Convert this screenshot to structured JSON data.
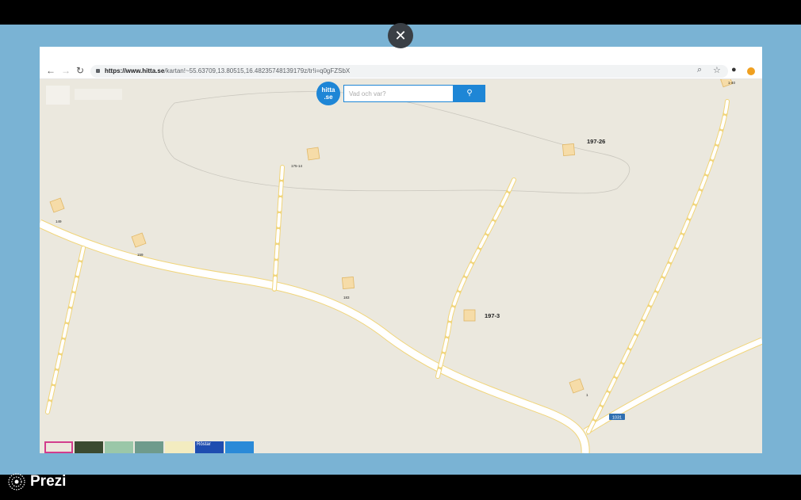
{
  "presentation": {
    "brand": "Prezi",
    "close_symbol": "✕"
  },
  "browser": {
    "url_host": "https://www.hitta.se",
    "url_path": "/kartan!~55.63709,13.80515,16.48235748139179z/tr!i=q0gFZSbX",
    "icons": [
      "back-arrow-icon",
      "forward-arrow-icon",
      "reload-icon",
      "lock-icon",
      "zoom-icon",
      "star-icon",
      "account-icon",
      "extension-icon"
    ]
  },
  "hitta": {
    "logo_line1": "hitta",
    "logo_line2": ".se",
    "search_placeholder": "Vad och var?"
  },
  "map": {
    "labels": {
      "l197_26": "197-26",
      "l197_3": "197-3",
      "l175_14": "175-14",
      "l149": "149",
      "l159": "159",
      "l183": "183",
      "l1": "1",
      "l1_40": "1-40",
      "road_1031": "1031"
    },
    "thumb_rostar": "Röstar"
  },
  "colors": {
    "map_bg": "#ebe8de",
    "road": "#ffffff",
    "road_edge": "#f1d57a",
    "building": "#f6dca8",
    "stage_blue": "#7ab3d4",
    "hitta_blue": "#1e86d6"
  }
}
